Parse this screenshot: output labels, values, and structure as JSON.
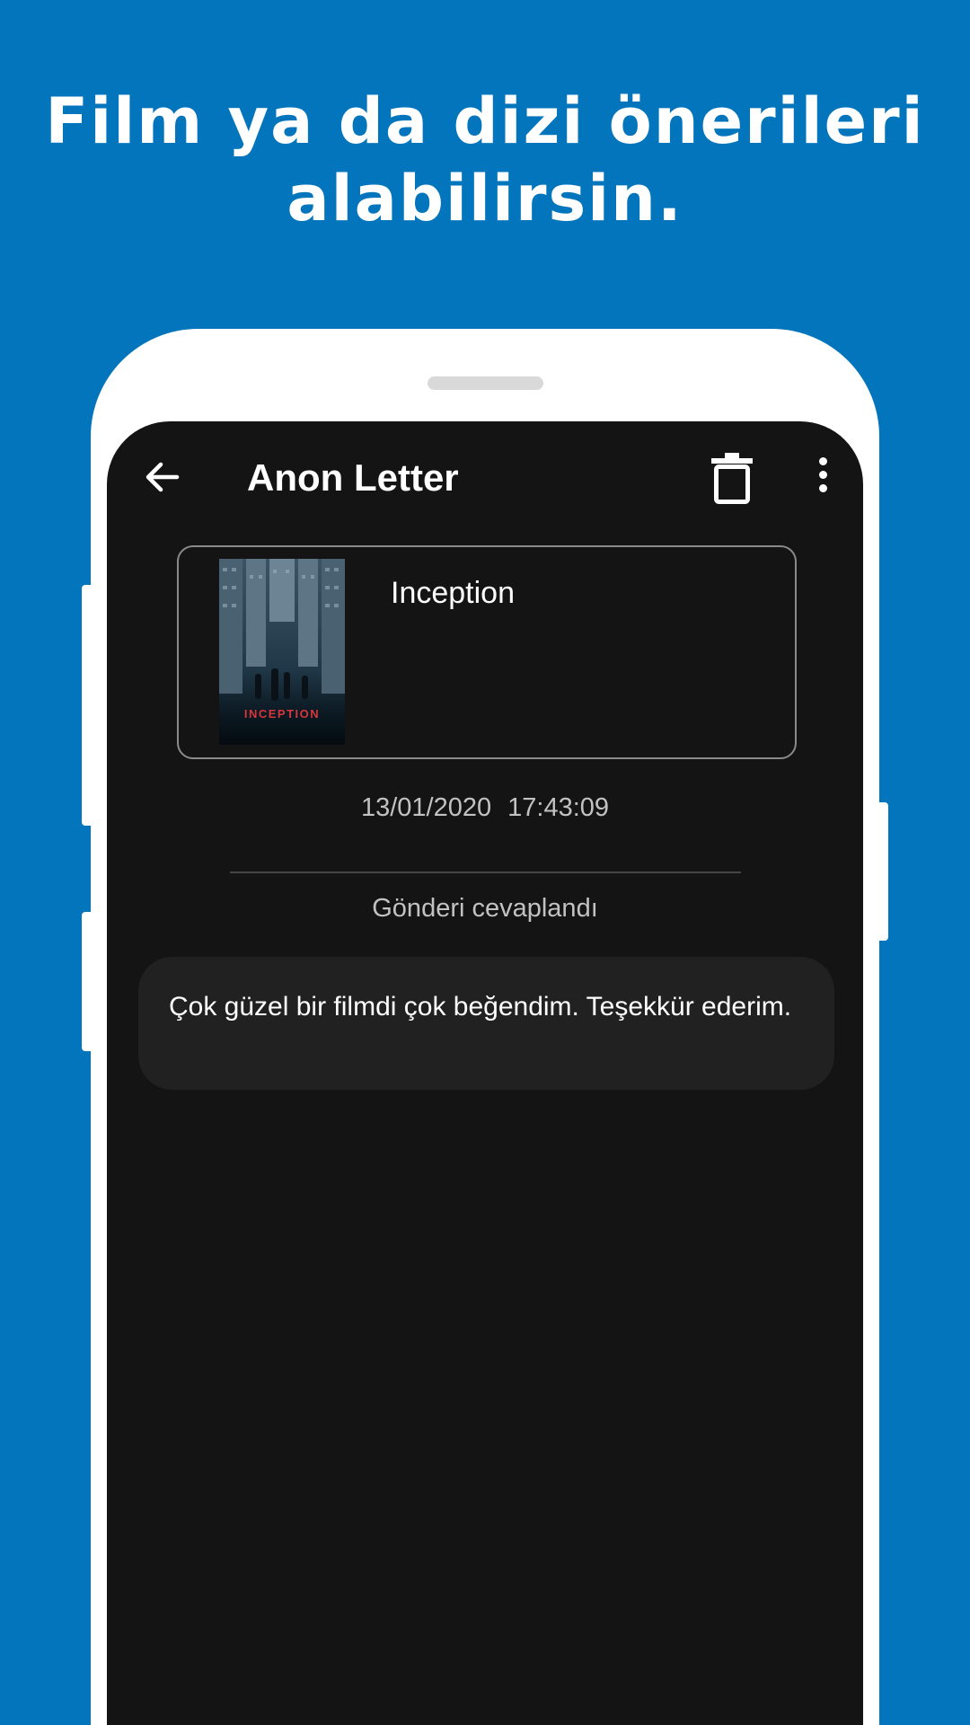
{
  "headline": {
    "line1": "Film ya da dizi önerileri",
    "line2": "alabilirsin."
  },
  "colors": {
    "background": "#0375bd",
    "screen": "#141414",
    "bubble": "#212121",
    "poster_title": "#d4373b"
  },
  "appbar": {
    "title": "Anon Letter",
    "back_icon": "arrow-left-icon",
    "delete_icon": "trash-icon",
    "menu_icon": "more-vertical-icon"
  },
  "movie": {
    "title": "Inception",
    "poster_text": "INCEPTION"
  },
  "message": {
    "timestamp": "13/01/2020  17:43:09",
    "status": "Gönderi cevaplandı",
    "reply": "Çok güzel bir filmdi çok beğendim. Teşekkür ederim."
  }
}
